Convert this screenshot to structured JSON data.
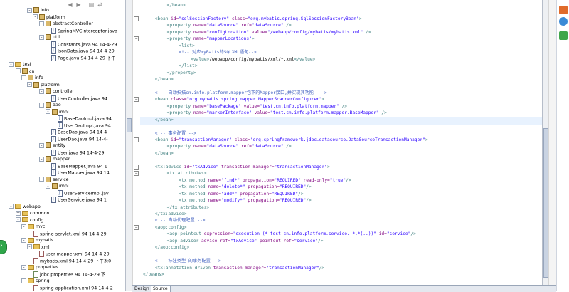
{
  "explorer": {
    "toolbar": {
      "back": "◀",
      "forward": "▶",
      "collapse": "▤",
      "link": "⇄"
    },
    "rows": [
      {
        "indent": 38,
        "icon": "pkg",
        "tw": "-",
        "label": "info"
      },
      {
        "indent": 46,
        "icon": "pkg",
        "tw": "-",
        "label": "platform"
      },
      {
        "indent": 55,
        "icon": "pkg",
        "tw": "-",
        "label": "abstractController"
      },
      {
        "indent": 72,
        "icon": "java",
        "tw": "",
        "label": "SpringMVCInterceptor.java"
      },
      {
        "indent": 55,
        "icon": "pkg",
        "tw": "-",
        "label": "util"
      },
      {
        "indent": 72,
        "icon": "java",
        "tw": "",
        "label": "Constants.java 94  14-4-29"
      },
      {
        "indent": 72,
        "icon": "java",
        "tw": "",
        "label": "JsonData.java 94  14-4-29"
      },
      {
        "indent": 72,
        "icon": "java",
        "tw": "",
        "label": "Page.java 94  14-4-29 下午"
      },
      {
        "indent": 12,
        "icon": "folder",
        "tw": "-",
        "label": "test"
      },
      {
        "indent": 22,
        "icon": "pkg",
        "tw": "-",
        "label": "cn"
      },
      {
        "indent": 30,
        "icon": "pkg",
        "tw": "-",
        "label": "info"
      },
      {
        "indent": 38,
        "icon": "pkg",
        "tw": "-",
        "label": "platform"
      },
      {
        "indent": 55,
        "icon": "pkg",
        "tw": "-",
        "label": "controller"
      },
      {
        "indent": 72,
        "icon": "java",
        "tw": "",
        "label": "UserController.java 94"
      },
      {
        "indent": 55,
        "icon": "pkg",
        "tw": "-",
        "label": "dao"
      },
      {
        "indent": 64,
        "icon": "pkg",
        "tw": "-",
        "label": "impl"
      },
      {
        "indent": 81,
        "icon": "java",
        "tw": "",
        "label": "BaseDaoImpl.java 94"
      },
      {
        "indent": 81,
        "icon": "java",
        "tw": "",
        "label": "UserDaoImpl.java 94"
      },
      {
        "indent": 72,
        "icon": "java",
        "tw": "",
        "label": "BaseDao.java 94  14-4-"
      },
      {
        "indent": 72,
        "icon": "java",
        "tw": "",
        "label": "UserDao.java 94  14-4-"
      },
      {
        "indent": 55,
        "icon": "pkg",
        "tw": "-",
        "label": "entity"
      },
      {
        "indent": 72,
        "icon": "java",
        "tw": "",
        "label": "User.java 94  14-4-29"
      },
      {
        "indent": 55,
        "icon": "pkg",
        "tw": "-",
        "label": "mapper"
      },
      {
        "indent": 72,
        "icon": "java",
        "tw": "",
        "label": "BaseMapper.java 94  1"
      },
      {
        "indent": 72,
        "icon": "java",
        "tw": "",
        "label": "UserMapper.java 94  14"
      },
      {
        "indent": 55,
        "icon": "pkg",
        "tw": "-",
        "label": "service"
      },
      {
        "indent": 64,
        "icon": "pkg",
        "tw": "-",
        "label": "impl"
      },
      {
        "indent": 81,
        "icon": "java",
        "tw": "",
        "label": "UserServiceImpl.jav"
      },
      {
        "indent": 72,
        "icon": "java",
        "tw": "",
        "label": "UserService.java 94  1"
      },
      {
        "indent": 12,
        "icon": "folder",
        "tw": "-",
        "label": "webapp"
      },
      {
        "indent": 22,
        "icon": "folder",
        "tw": "+",
        "label": "common"
      },
      {
        "indent": 22,
        "icon": "folder",
        "tw": "-",
        "label": "config"
      },
      {
        "indent": 30,
        "icon": "folder",
        "tw": "-",
        "label": "mvc"
      },
      {
        "indent": 47,
        "icon": "xml",
        "tw": "",
        "label": "spring-servlet.xml 94  14-4-29"
      },
      {
        "indent": 30,
        "icon": "folder",
        "tw": "-",
        "label": "mybatis"
      },
      {
        "indent": 38,
        "icon": "folder",
        "tw": "-",
        "label": "xml"
      },
      {
        "indent": 55,
        "icon": "xml",
        "tw": "",
        "label": "user-mapper.xml 94  14-4-29"
      },
      {
        "indent": 47,
        "icon": "xml",
        "tw": "",
        "label": "mybatis.xml 94  14-4-29 下午3:0"
      },
      {
        "indent": 30,
        "icon": "folder",
        "tw": "-",
        "label": "properties"
      },
      {
        "indent": 47,
        "icon": "prop",
        "tw": "",
        "label": "jdbc.properties 94  14-4-29 下"
      },
      {
        "indent": 30,
        "icon": "folder",
        "tw": "-",
        "label": "spring"
      },
      {
        "indent": 47,
        "icon": "xml",
        "tw": "",
        "label": "spring-application.xml 94  14-4-2"
      }
    ]
  },
  "editor": {
    "lines": [
      {
        "indent": 8,
        "parts": [
          [
            "t",
            "</bean>"
          ]
        ]
      },
      {
        "indent": 0,
        "parts": []
      },
      {
        "indent": 4,
        "parts": [
          [
            "t",
            "<bean "
          ],
          [
            "a",
            "id="
          ],
          [
            "v",
            "\"sqlSessionFactory\" "
          ],
          [
            "a",
            "class="
          ],
          [
            "v",
            "\"org.mybatis.spring.SqlSessionFactoryBean\""
          ],
          [
            "t",
            ">"
          ]
        ]
      },
      {
        "indent": 8,
        "parts": [
          [
            "t",
            "<property "
          ],
          [
            "a",
            "name="
          ],
          [
            "v",
            "\"dataSource\" "
          ],
          [
            "a",
            "ref="
          ],
          [
            "v",
            "\"dataSource\" "
          ],
          [
            "t",
            "/>"
          ]
        ]
      },
      {
        "indent": 8,
        "parts": [
          [
            "t",
            "<property "
          ],
          [
            "a",
            "name="
          ],
          [
            "v",
            "\"configLocation\" "
          ],
          [
            "a",
            "value="
          ],
          [
            "v",
            "\"/webapp/config/mybatis/mybatis.xml\" "
          ],
          [
            "t",
            "/>"
          ]
        ]
      },
      {
        "indent": 8,
        "parts": [
          [
            "t",
            "<property "
          ],
          [
            "a",
            "name="
          ],
          [
            "v",
            "\"mapperLocations\""
          ],
          [
            "t",
            ">"
          ]
        ]
      },
      {
        "indent": 12,
        "parts": [
          [
            "t",
            "<list>"
          ]
        ]
      },
      {
        "indent": 12,
        "parts": [
          [
            "c",
            "<!-- 对应myBaits的SQLXML语句-->"
          ]
        ]
      },
      {
        "indent": 16,
        "parts": [
          [
            "t",
            "<value>"
          ],
          [
            "",
            "/webapp/config/mybatis/xml/*.xml"
          ],
          [
            "t",
            "</value>"
          ]
        ]
      },
      {
        "indent": 12,
        "parts": [
          [
            "t",
            "</list>"
          ]
        ]
      },
      {
        "indent": 8,
        "parts": [
          [
            "t",
            "</property>"
          ]
        ]
      },
      {
        "indent": 4,
        "parts": [
          [
            "t",
            "</bean>"
          ]
        ]
      },
      {
        "indent": 0,
        "parts": []
      },
      {
        "indent": 4,
        "parts": [
          [
            "c",
            "<!-- 自动扫描cn.info.platform.mapper包下的Mapper接口,并实现其功能  -->"
          ]
        ]
      },
      {
        "indent": 4,
        "parts": [
          [
            "t",
            "<bean "
          ],
          [
            "a",
            "class="
          ],
          [
            "v",
            "\"org.mybatis.spring.mapper.MapperScannerConfigurer\""
          ],
          [
            "t",
            ">"
          ]
        ]
      },
      {
        "indent": 8,
        "parts": [
          [
            "t",
            "<property "
          ],
          [
            "a",
            "name="
          ],
          [
            "v",
            "\"basePackage\" "
          ],
          [
            "a",
            "value="
          ],
          [
            "v",
            "\"test.cn.info.platform.mapper\" "
          ],
          [
            "t",
            "/>"
          ]
        ]
      },
      {
        "indent": 8,
        "parts": [
          [
            "t",
            "<property "
          ],
          [
            "a",
            "name="
          ],
          [
            "v",
            "\"markerInterface\" "
          ],
          [
            "a",
            "value="
          ],
          [
            "v",
            "\"test.cn.info.platform.mapper.BaseMapper\" "
          ],
          [
            "t",
            "/>"
          ]
        ]
      },
      {
        "indent": 4,
        "parts": [
          [
            "t",
            "</bean>"
          ]
        ]
      },
      {
        "indent": 0,
        "parts": []
      },
      {
        "indent": 4,
        "parts": [
          [
            "c",
            "<!-- 事务配置 -->"
          ]
        ]
      },
      {
        "indent": 4,
        "parts": [
          [
            "t",
            "<bean "
          ],
          [
            "a",
            "id="
          ],
          [
            "v",
            "\"transactionManager\" "
          ],
          [
            "a",
            "class="
          ],
          [
            "v",
            "\"org.springframework.jdbc.datasource.DataSourceTransactionManager\""
          ],
          [
            "t",
            ">"
          ]
        ]
      },
      {
        "indent": 8,
        "parts": [
          [
            "t",
            "<property "
          ],
          [
            "a",
            "name="
          ],
          [
            "v",
            "\"dataSource\" "
          ],
          [
            "a",
            "ref="
          ],
          [
            "v",
            "\"dataSource\" "
          ],
          [
            "t",
            "/>"
          ]
        ]
      },
      {
        "indent": 4,
        "parts": [
          [
            "t",
            "</bean>"
          ]
        ]
      },
      {
        "indent": 0,
        "parts": []
      },
      {
        "indent": 4,
        "parts": [
          [
            "t",
            "<tx:advice "
          ],
          [
            "a",
            "id="
          ],
          [
            "v",
            "\"txAdvice\" "
          ],
          [
            "a",
            "transaction-manager="
          ],
          [
            "v",
            "\"transactionManager\""
          ],
          [
            "t",
            ">"
          ]
        ]
      },
      {
        "indent": 8,
        "parts": [
          [
            "t",
            "<tx:attributes>"
          ]
        ]
      },
      {
        "indent": 12,
        "parts": [
          [
            "t",
            "<tx:method "
          ],
          [
            "a",
            "name="
          ],
          [
            "v",
            "\"find*\" "
          ],
          [
            "a",
            "propagation="
          ],
          [
            "v",
            "\"REQUIRED\" "
          ],
          [
            "a",
            "read-only="
          ],
          [
            "v",
            "\"true\""
          ],
          [
            "t",
            "/>"
          ]
        ]
      },
      {
        "indent": 12,
        "parts": [
          [
            "t",
            "<tx:method "
          ],
          [
            "a",
            "name="
          ],
          [
            "v",
            "\"delete*\" "
          ],
          [
            "a",
            "propagation="
          ],
          [
            "v",
            "\"REQUIRED\""
          ],
          [
            "t",
            "/>"
          ]
        ]
      },
      {
        "indent": 12,
        "parts": [
          [
            "t",
            "<tx:method "
          ],
          [
            "a",
            "name="
          ],
          [
            "v",
            "\"add*\" "
          ],
          [
            "a",
            "propagation="
          ],
          [
            "v",
            "\"REQUIRED\""
          ],
          [
            "t",
            "/>"
          ]
        ]
      },
      {
        "indent": 12,
        "parts": [
          [
            "t",
            "<tx:method "
          ],
          [
            "a",
            "name="
          ],
          [
            "v",
            "\"modify*\" "
          ],
          [
            "a",
            "propagation="
          ],
          [
            "v",
            "\"REQUIRED\""
          ],
          [
            "t",
            "/>"
          ]
        ]
      },
      {
        "indent": 8,
        "parts": [
          [
            "t",
            "</tx:attributes>"
          ]
        ]
      },
      {
        "indent": 4,
        "parts": [
          [
            "t",
            "</tx:advice>"
          ]
        ]
      },
      {
        "indent": 4,
        "parts": [
          [
            "c",
            "<!-- 自动代理配置 -->"
          ]
        ]
      },
      {
        "indent": 4,
        "parts": [
          [
            "t",
            "<aop:config>"
          ]
        ]
      },
      {
        "indent": 8,
        "parts": [
          [
            "t",
            "<aop:pointcut "
          ],
          [
            "a",
            "expression="
          ],
          [
            "v",
            "\"execution (* test.cn.info.platform.service..*.*(..))\" "
          ],
          [
            "a",
            "id="
          ],
          [
            "v",
            "\"service\""
          ],
          [
            "t",
            "/>"
          ]
        ]
      },
      {
        "indent": 8,
        "parts": [
          [
            "t",
            "<aop:advisor "
          ],
          [
            "a",
            "advice-ref="
          ],
          [
            "v",
            "\"txAdvice\" "
          ],
          [
            "a",
            "pointcut-ref="
          ],
          [
            "v",
            "\"service\""
          ],
          [
            "t",
            "/>"
          ]
        ]
      },
      {
        "indent": 4,
        "parts": [
          [
            "t",
            "</aop:config>"
          ]
        ]
      },
      {
        "indent": 0,
        "parts": []
      },
      {
        "indent": 4,
        "parts": [
          [
            "c",
            "<!-- 标注类型 的事务配置 -->"
          ]
        ]
      },
      {
        "indent": 4,
        "parts": [
          [
            "t",
            "<tx:annotation-driven "
          ],
          [
            "a",
            "transaction-manager="
          ],
          [
            "v",
            "\"transactionManager\""
          ],
          [
            "t",
            "/>"
          ]
        ]
      },
      {
        "indent": 0,
        "parts": [
          [
            "t",
            "</beans>"
          ]
        ]
      }
    ]
  },
  "tabs": [
    {
      "label": "Design",
      "active": false
    },
    {
      "label": "Source",
      "active": true
    }
  ],
  "colors": {
    "tag": "#3f7f7f",
    "attr": "#7f007f",
    "value": "#2a00ff",
    "comment": "#3f5fbf"
  }
}
